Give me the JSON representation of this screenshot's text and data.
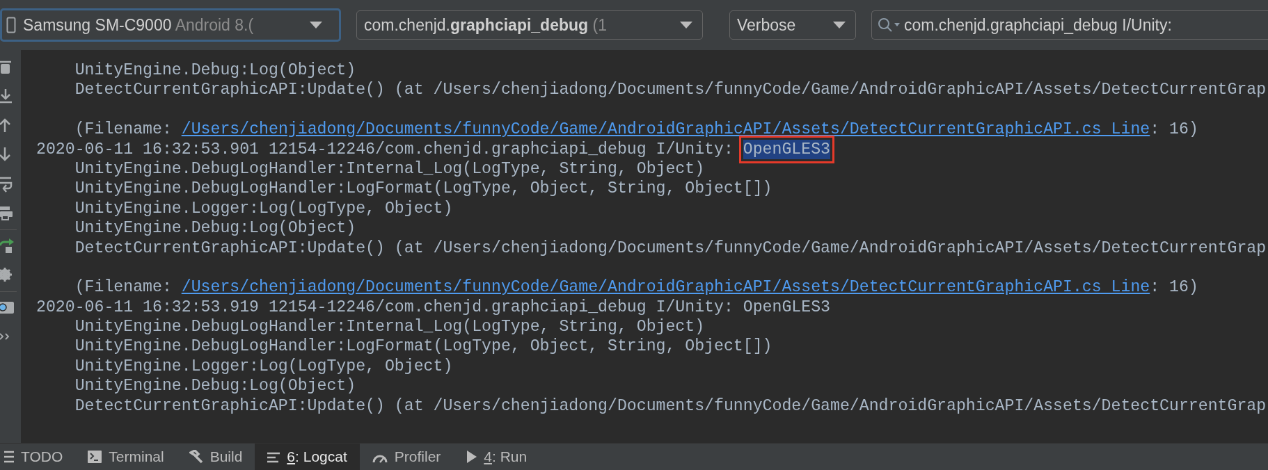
{
  "toolbar": {
    "device": {
      "name": "Samsung SM-C9000",
      "detail": "Android 8.(",
      "focused": true
    },
    "process": {
      "package": "com.chenjd.",
      "app": "graphciapi_debug",
      "pid": "(1"
    },
    "level": "Verbose",
    "search": {
      "value": "com.chenjd.graphciapi_debug I/Unity:"
    }
  },
  "log_lines": [
    {
      "kind": "plain",
      "text": "    UnityEngine.Debug:Log(Object)"
    },
    {
      "kind": "plain",
      "text": "    DetectCurrentGraphicAPI:Update() (at /Users/chenjiadong/Documents/funnyCode/Game/AndroidGraphicAPI/Assets/DetectCurrentGrap"
    },
    {
      "kind": "blank"
    },
    {
      "kind": "filename",
      "prefix": "    (Filename: ",
      "link": "/Users/chenjiadong/Documents/funnyCode/Game/AndroidGraphicAPI/Assets/DetectCurrentGraphicAPI.cs Line",
      "suffix": ": 16)"
    },
    {
      "kind": "entry",
      "text": "2020-06-11 16:32:53.901 12154-12246/com.chenjd.graphciapi_debug I/Unity: ",
      "message": "OpenGLES3",
      "selected": true
    },
    {
      "kind": "plain",
      "text": "    UnityEngine.DebugLogHandler:Internal_Log(LogType, String, Object)"
    },
    {
      "kind": "plain",
      "text": "    UnityEngine.DebugLogHandler:LogFormat(LogType, Object, String, Object[])"
    },
    {
      "kind": "plain",
      "text": "    UnityEngine.Logger:Log(LogType, Object)"
    },
    {
      "kind": "plain",
      "text": "    UnityEngine.Debug:Log(Object)"
    },
    {
      "kind": "plain",
      "text": "    DetectCurrentGraphicAPI:Update() (at /Users/chenjiadong/Documents/funnyCode/Game/AndroidGraphicAPI/Assets/DetectCurrentGrap"
    },
    {
      "kind": "blank"
    },
    {
      "kind": "filename",
      "prefix": "    (Filename: ",
      "link": "/Users/chenjiadong/Documents/funnyCode/Game/AndroidGraphicAPI/Assets/DetectCurrentGraphicAPI.cs Line",
      "suffix": ": 16)"
    },
    {
      "kind": "entry",
      "text": "2020-06-11 16:32:53.919 12154-12246/com.chenjd.graphciapi_debug I/Unity: ",
      "message": "OpenGLES3",
      "selected": false
    },
    {
      "kind": "plain",
      "text": "    UnityEngine.DebugLogHandler:Internal_Log(LogType, String, Object)"
    },
    {
      "kind": "plain",
      "text": "    UnityEngine.DebugLogHandler:LogFormat(LogType, Object, String, Object[])"
    },
    {
      "kind": "plain",
      "text": "    UnityEngine.Logger:Log(LogType, Object)"
    },
    {
      "kind": "plain",
      "text": "    UnityEngine.Debug:Log(Object)"
    },
    {
      "kind": "plain",
      "text": "    DetectCurrentGraphicAPI:Update() (at /Users/chenjiadong/Documents/funnyCode/Game/AndroidGraphicAPI/Assets/DetectCurrentGrap"
    }
  ],
  "tool_tabs": [
    {
      "label": "TODO",
      "mnemonic": false,
      "selected": false
    },
    {
      "label": "Terminal",
      "mnemonic": false,
      "selected": false
    },
    {
      "label": "Build",
      "mnemonic": false,
      "selected": false
    },
    {
      "label": "6: Logcat",
      "mnemonic": true,
      "selected": true
    },
    {
      "label": "Profiler",
      "mnemonic": false,
      "selected": false
    },
    {
      "label": "4: Run",
      "mnemonic": true,
      "selected": false
    }
  ]
}
